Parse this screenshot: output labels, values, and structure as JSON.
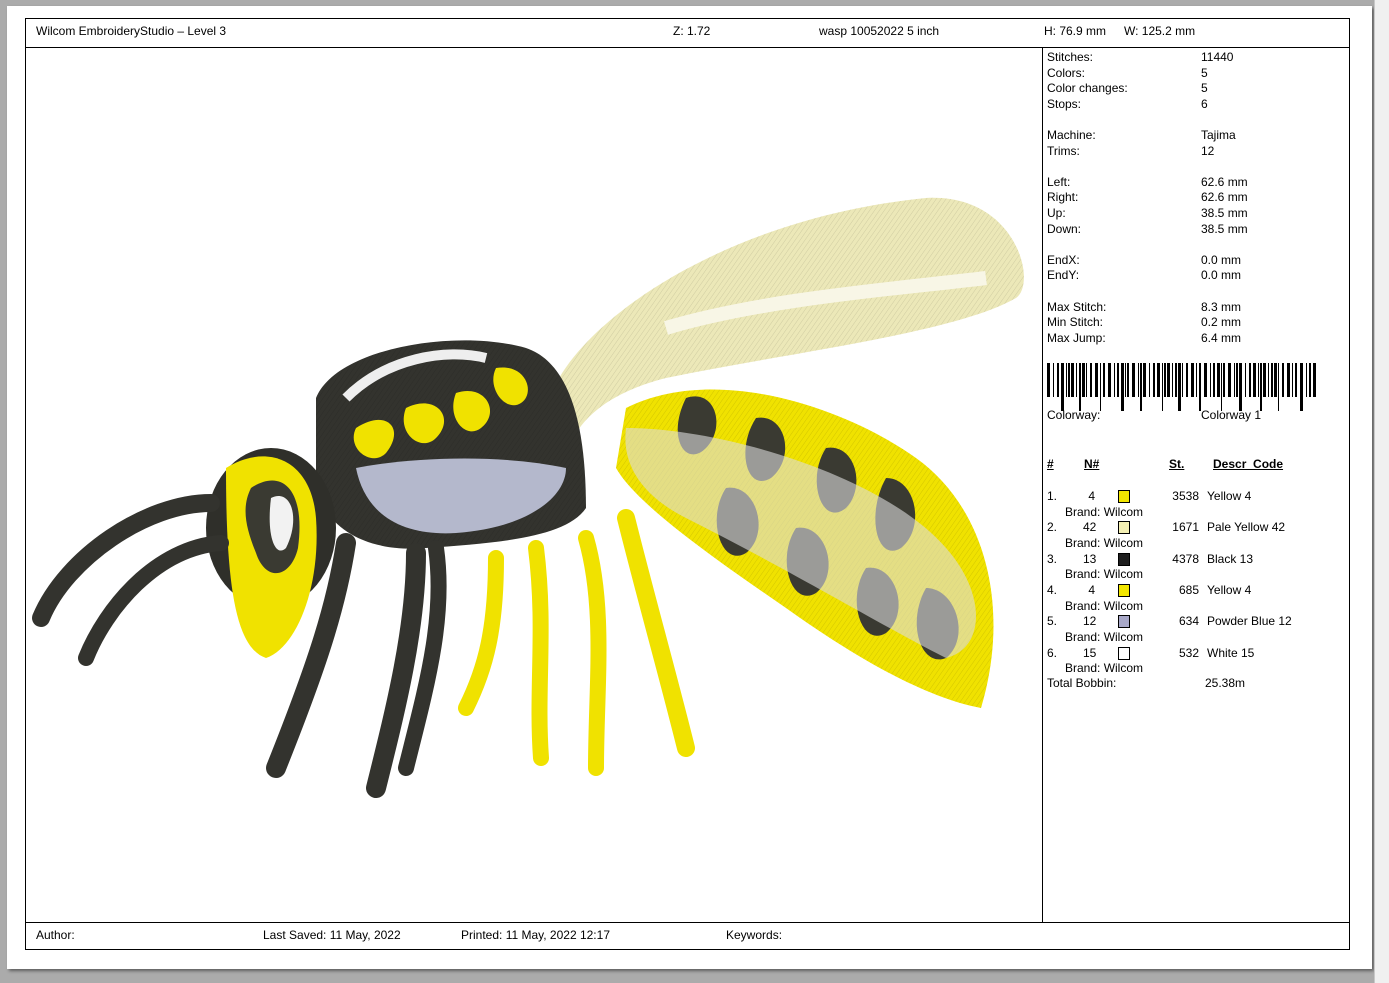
{
  "header": {
    "app_title": "Wilcom EmbroideryStudio – Level 3",
    "zoom": "Z: 1.72",
    "design_name": "wasp 10052022 5 inch",
    "height": "H: 76.9 mm",
    "width": "W: 125.2 mm"
  },
  "stats": [
    {
      "k": "Stitches:",
      "v": "11440"
    },
    {
      "k": "Colors:",
      "v": "5"
    },
    {
      "k": "Color changes:",
      "v": "5"
    },
    {
      "k": "Stops:",
      "v": "6"
    },
    {
      "k": "Machine:",
      "v": "Tajima"
    },
    {
      "k": "Trims:",
      "v": "12"
    },
    {
      "k": "Left:",
      "v": "62.6 mm"
    },
    {
      "k": "Right:",
      "v": "62.6 mm"
    },
    {
      "k": "Up:",
      "v": "38.5 mm"
    },
    {
      "k": "Down:",
      "v": "38.5 mm"
    },
    {
      "k": "EndX:",
      "v": "0.0 mm"
    },
    {
      "k": "EndY:",
      "v": "0.0 mm"
    },
    {
      "k": "Max Stitch:",
      "v": "8.3 mm"
    },
    {
      "k": "Min Stitch:",
      "v": "0.2 mm"
    },
    {
      "k": "Max Jump:",
      "v": "6.4 mm"
    }
  ],
  "colorway": {
    "label": "Colorway:",
    "value": "Colorway 1"
  },
  "table_headers": {
    "num": "#",
    "n": "N#",
    "st": "St.",
    "descr": "Descr_Code"
  },
  "colors": [
    {
      "num": "1.",
      "n": "4",
      "hex": "#f2e600",
      "st": "3538",
      "descr": "Yellow 4",
      "brand": "Brand: Wilcom"
    },
    {
      "num": "2.",
      "n": "42",
      "hex": "#f4f0b4",
      "st": "1671",
      "descr": "Pale Yellow 42",
      "brand": "Brand: Wilcom"
    },
    {
      "num": "3.",
      "n": "13",
      "hex": "#1e1e1e",
      "st": "4378",
      "descr": "Black 13",
      "brand": "Brand: Wilcom"
    },
    {
      "num": "4.",
      "n": "4",
      "hex": "#f2e600",
      "st": "685",
      "descr": "Yellow 4",
      "brand": "Brand: Wilcom"
    },
    {
      "num": "5.",
      "n": "12",
      "hex": "#a8a8c8",
      "st": "634",
      "descr": "Powder Blue 12",
      "brand": "Brand: Wilcom"
    },
    {
      "num": "6.",
      "n": "15",
      "hex": "#ffffff",
      "st": "532",
      "descr": "White 15",
      "brand": "Brand: Wilcom"
    }
  ],
  "total_bobbin": {
    "label": "Total Bobbin:",
    "value": "25.38m"
  },
  "footer": {
    "author": "Author:",
    "last_saved": "Last Saved: 11 May, 2022",
    "printed": "Printed: 11 May, 2022 12:17",
    "keywords": "Keywords:"
  }
}
